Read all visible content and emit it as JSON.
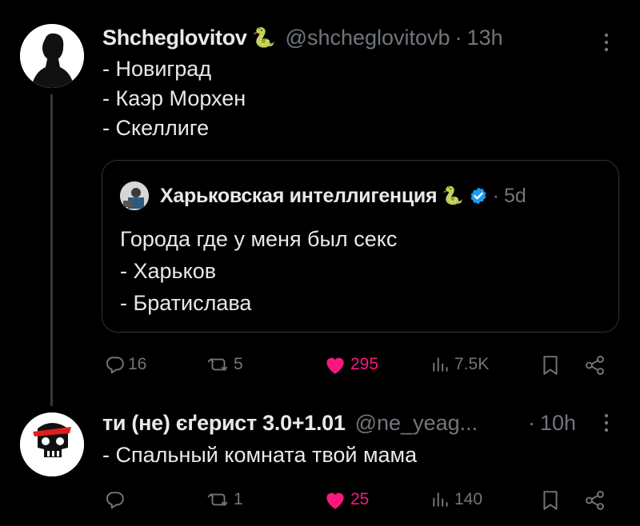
{
  "tweet1": {
    "display_name": "Shcheglovitov",
    "badge_emoji": "🐍",
    "handle": "@shcheglovitovb",
    "separator": "·",
    "time": "13h",
    "lines": [
      "- Новиград",
      "- Каэр Морхен",
      "- Скеллиге"
    ],
    "quote": {
      "display_name": "Харьковская интеллигенция",
      "badge_emoji": "🐍",
      "verified": true,
      "separator": "·",
      "time": "5d",
      "lines": [
        "Города где у меня был секс",
        "- Харьков",
        "- Братислава"
      ]
    },
    "actions": {
      "replies": "16",
      "reposts": "5",
      "likes": "295",
      "views": "7.5K"
    }
  },
  "tweet2": {
    "display_name": "ти (не) єґерист 3.0+1.01",
    "handle": "@ne_yeag...",
    "separator": "·",
    "time": "10h",
    "lines": [
      "- Спальный комната твой мама"
    ],
    "actions": {
      "replies": "",
      "reposts": "1",
      "likes": "25",
      "views": "140"
    }
  },
  "colors": {
    "background": "#000000",
    "text": "#e7e9ea",
    "muted": "#71767b",
    "like": "#f91880",
    "verified": "#1d9bf0",
    "border": "#2f3336"
  },
  "icons": [
    "reply-icon",
    "repost-icon",
    "heart-icon",
    "views-icon",
    "bookmark-icon",
    "share-icon",
    "more-icon",
    "verified-icon"
  ]
}
